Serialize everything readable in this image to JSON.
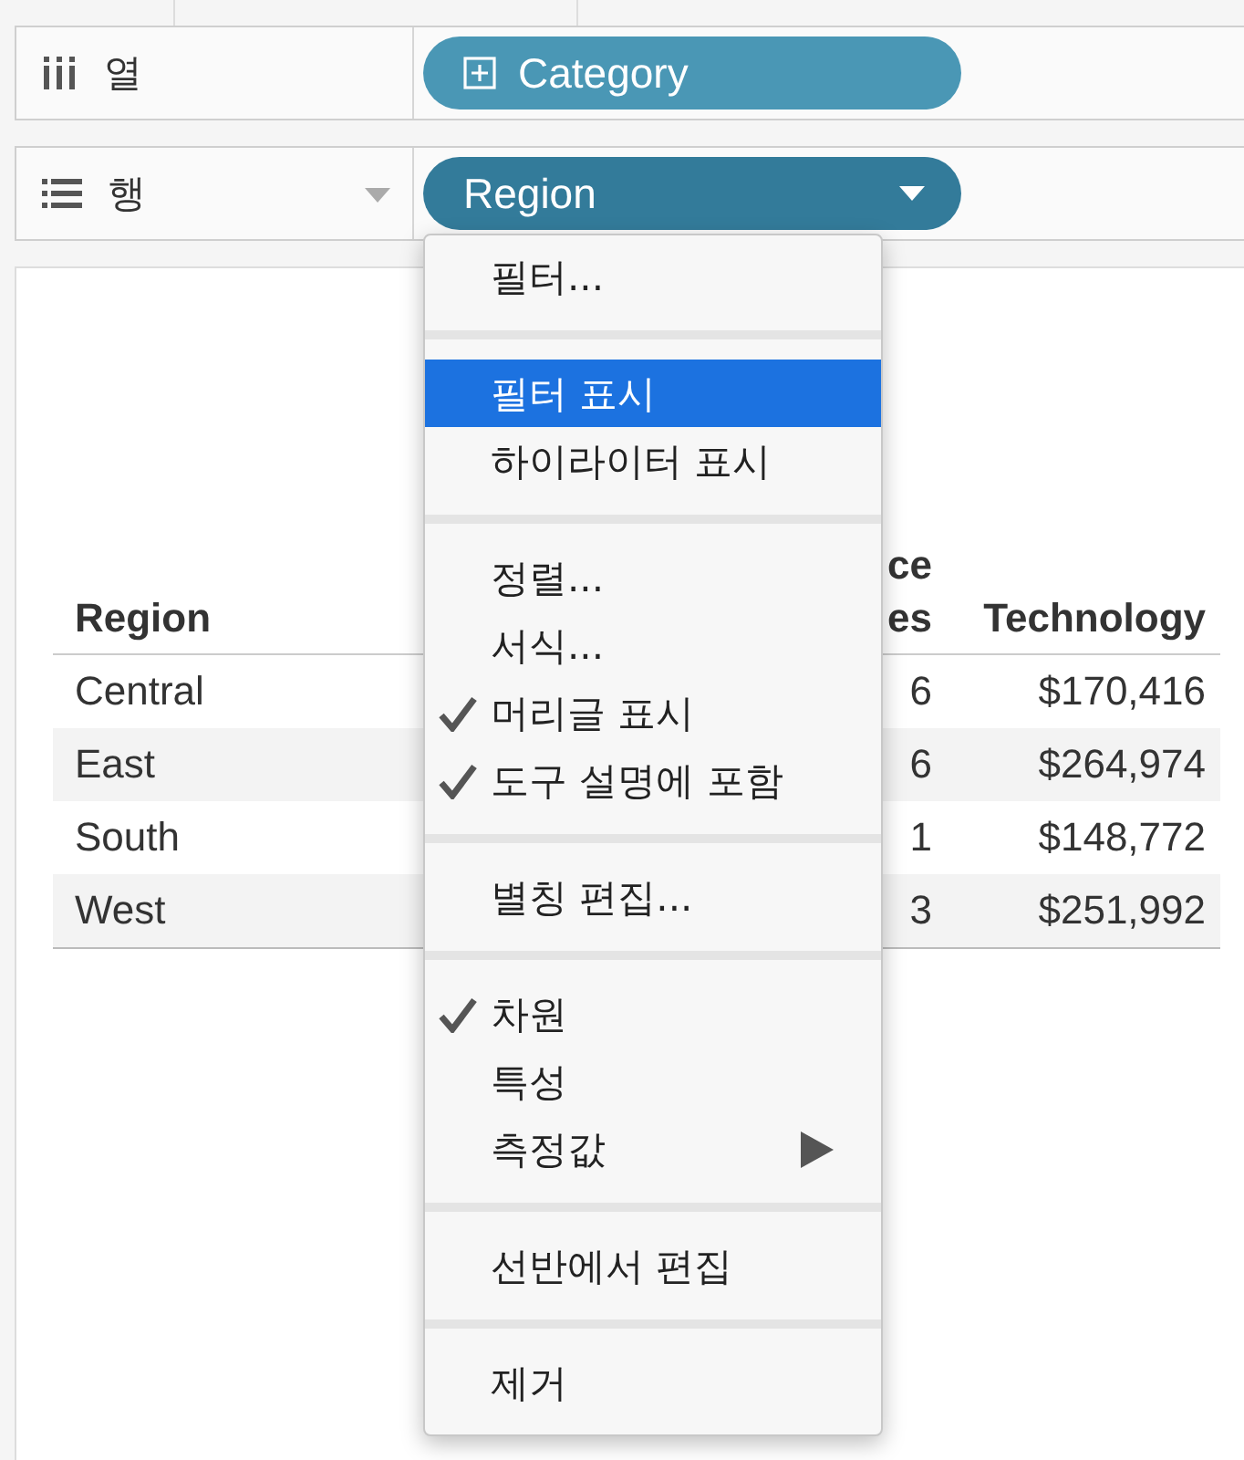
{
  "shelves": [
    {
      "kind": "columns",
      "label": "열",
      "pill": {
        "label": "Category",
        "expandable": true,
        "has_dropdown": false
      },
      "label_dropdown": false
    },
    {
      "kind": "rows",
      "label": "행",
      "pill": {
        "label": "Region",
        "expandable": false,
        "has_dropdown": true
      },
      "label_dropdown": true
    }
  ],
  "table": {
    "columns": [
      {
        "header": [
          "Region"
        ]
      },
      {
        "header": [
          "ce",
          "es"
        ]
      },
      {
        "header": [
          "Technology"
        ]
      }
    ],
    "rows": [
      {
        "cells": [
          "Central",
          "6",
          "$170,416"
        ]
      },
      {
        "cells": [
          "East",
          "6",
          "$264,974"
        ]
      },
      {
        "cells": [
          "South",
          "1",
          "$148,772"
        ]
      },
      {
        "cells": [
          "West",
          "3",
          "$251,992"
        ]
      }
    ]
  },
  "menu": {
    "sections": [
      [
        {
          "label": "필터...",
          "checked": false,
          "selected": false,
          "submenu": false
        }
      ],
      [
        {
          "label": "필터 표시",
          "checked": false,
          "selected": true,
          "submenu": false
        },
        {
          "label": "하이라이터 표시",
          "checked": false,
          "selected": false,
          "submenu": false
        }
      ],
      [
        {
          "label": "정렬...",
          "checked": false,
          "selected": false,
          "submenu": false
        },
        {
          "label": "서식...",
          "checked": false,
          "selected": false,
          "submenu": false
        },
        {
          "label": "머리글 표시",
          "checked": true,
          "selected": false,
          "submenu": false
        },
        {
          "label": "도구 설명에 포함",
          "checked": true,
          "selected": false,
          "submenu": false
        }
      ],
      [
        {
          "label": "별칭 편집...",
          "checked": false,
          "selected": false,
          "submenu": false
        }
      ],
      [
        {
          "label": "차원",
          "checked": true,
          "selected": false,
          "submenu": false
        },
        {
          "label": "특성",
          "checked": false,
          "selected": false,
          "submenu": false
        },
        {
          "label": "측정값",
          "checked": false,
          "selected": false,
          "submenu": true
        }
      ],
      [
        {
          "label": "선반에서 편집",
          "checked": false,
          "selected": false,
          "submenu": false
        }
      ],
      [
        {
          "label": "제거",
          "checked": false,
          "selected": false,
          "submenu": false
        }
      ]
    ]
  }
}
